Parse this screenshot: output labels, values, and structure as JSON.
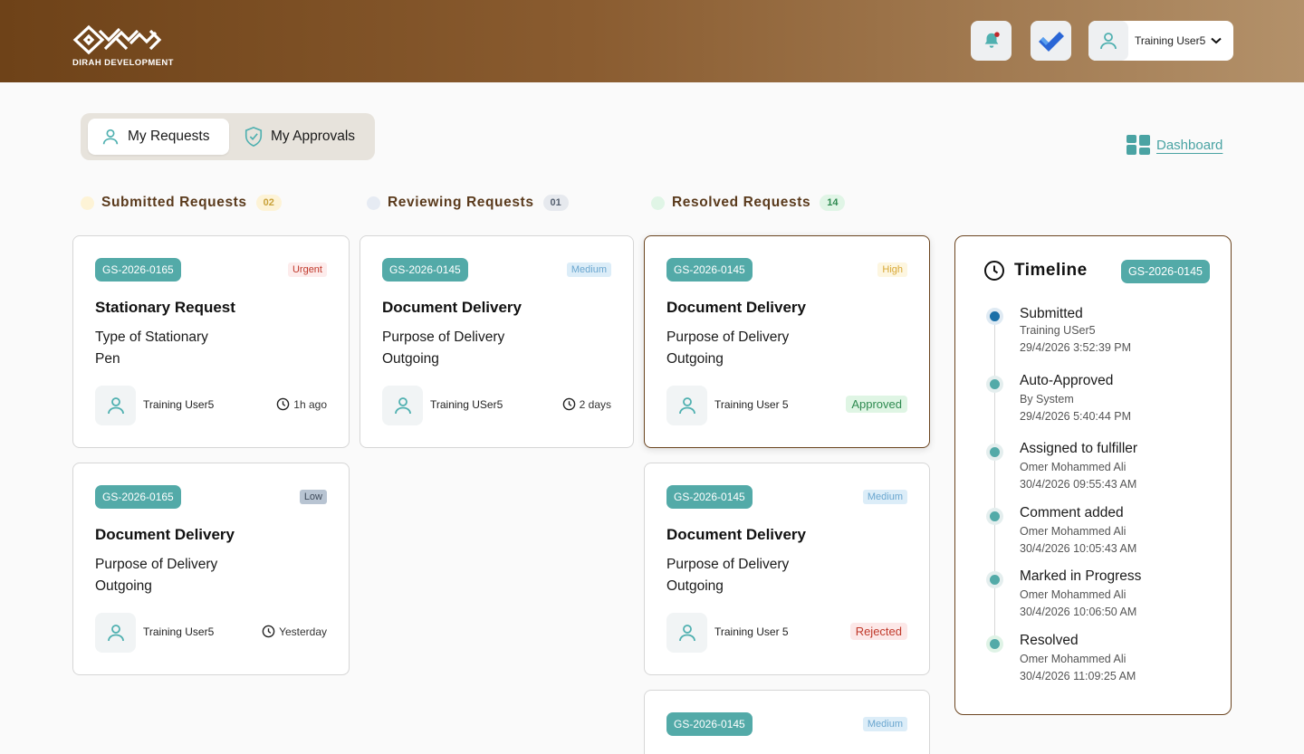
{
  "header": {
    "logo_text": "DIRAH DEVELOPMENT",
    "user_name": "Training User5"
  },
  "tabs": {
    "my_requests": "My Requests",
    "my_approvals": "My Approvals"
  },
  "dashboard_label": "Dashboard",
  "columns": {
    "submitted": {
      "title": "Submitted Requests",
      "count": "02"
    },
    "reviewing": {
      "title": "Reviewing Requests",
      "count": "01"
    },
    "resolved": {
      "title": "Resolved Requests",
      "count": "14"
    }
  },
  "cards": [
    {
      "code": "GS-2026-0165",
      "priority": "Urgent",
      "title": "Stationary Request",
      "line1": "Type of Stationary",
      "line2": "Pen",
      "user": "Training User5",
      "time": "1h ago"
    },
    {
      "code": "GS-2026-0165",
      "priority": "Low",
      "title": "Document Delivery",
      "line1": "Purpose of Delivery",
      "line2": "Outgoing",
      "user": "Training User5",
      "time": "Yesterday"
    },
    {
      "code": "GS-2026-0145",
      "priority": "Medium",
      "title": "Document Delivery",
      "line1": "Purpose of Delivery",
      "line2": "Outgoing",
      "user": "Training USer5",
      "time": "2 days"
    },
    {
      "code": "GS-2026-0145",
      "priority": "High",
      "title": "Document Delivery",
      "line1": "Purpose of Delivery",
      "line2": "Outgoing",
      "user": "Training User 5",
      "status": "Approved"
    },
    {
      "code": "GS-2026-0145",
      "priority": "Medium",
      "title": "Document Delivery",
      "line1": "Purpose of Delivery",
      "line2": "Outgoing",
      "user": "Training User 5",
      "status": "Rejected"
    },
    {
      "code": "GS-2026-0145",
      "priority": "Medium"
    }
  ],
  "timeline": {
    "title": "Timeline",
    "code": "GS-2026-0145",
    "events": [
      {
        "title": "Submitted",
        "by": "Training USer5",
        "date": "29/4/2026 3:52:39 PM"
      },
      {
        "title": "Auto-Approved",
        "by": "By System",
        "date": "29/4/2026 5:40:44 PM"
      },
      {
        "title": "Assigned to fulfiller",
        "by": "Omer Mohammed Ali",
        "date": "30/4/2026 09:55:43 AM"
      },
      {
        "title": "Comment added",
        "by": "Omer Mohammed Ali",
        "date": "30/4/2026 10:05:43 AM"
      },
      {
        "title": "Marked in Progress",
        "by": "Omer Mohammed Ali",
        "date": "30/4/2026 10:06:50 AM"
      },
      {
        "title": "Resolved",
        "by": "Omer Mohammed Ali",
        "date": "30/4/2026 11:09:25 AM"
      }
    ]
  },
  "colors": {
    "accent_teal": "#53aaa8",
    "brand_brown": "#6b4520"
  }
}
